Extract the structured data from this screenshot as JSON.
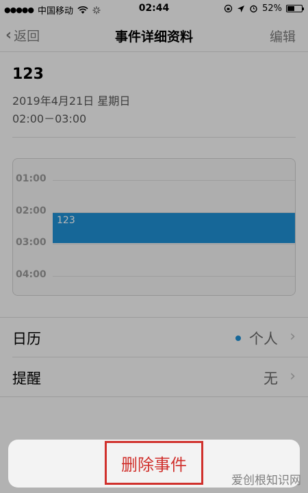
{
  "status_bar": {
    "signal": "●●●●●",
    "carrier": "中国移动",
    "time": "02:44",
    "battery": "52%",
    "battery_level": 0.52
  },
  "nav": {
    "back": "返回",
    "title": "事件详细资料",
    "edit": "编辑"
  },
  "event": {
    "title": "123",
    "date": "2019年4月21日 星期日",
    "time": "02:00－03:00"
  },
  "timeline": {
    "hours": [
      "01:00",
      "02:00",
      "03:00",
      "04:00"
    ],
    "event_label": "123",
    "event_color": "#1f8fd3"
  },
  "details": [
    {
      "label": "日历",
      "value": "个人",
      "dot_color": "#1f8fd3"
    },
    {
      "label": "提醒",
      "value": "无"
    }
  ],
  "action_sheet": {
    "delete": "删除事件",
    "delete_color": "#d0302c"
  },
  "watermark": "爱创根知识网"
}
